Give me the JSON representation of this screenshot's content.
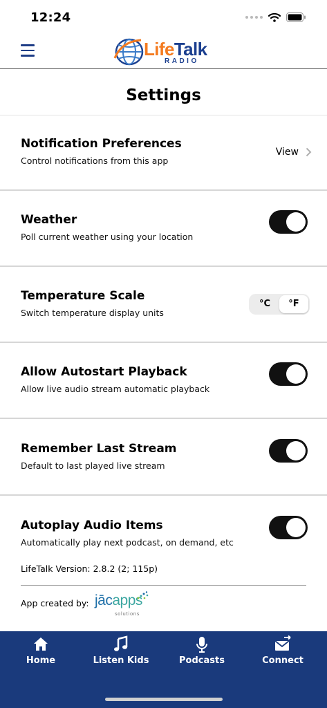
{
  "status_bar": {
    "time": "12:24"
  },
  "header": {
    "logo_word_1": "Life",
    "logo_word_2": "Talk",
    "logo_sub": "RADIO"
  },
  "page": {
    "title": "Settings"
  },
  "settings": [
    {
      "title": "Notification Preferences",
      "description": "Control notifications from this app",
      "action_label": "View"
    },
    {
      "title": "Weather",
      "description": "Poll current weather using your location",
      "enabled": true
    },
    {
      "title": "Temperature Scale",
      "description": "Switch temperature display units",
      "options": [
        "°C",
        "°F"
      ],
      "selected": "°F"
    },
    {
      "title": "Allow Autostart Playback",
      "description": "Allow live audio stream automatic playback",
      "enabled": true
    },
    {
      "title": "Remember Last Stream",
      "description": "Default to last played live stream",
      "enabled": true
    },
    {
      "title": "Autoplay Audio Items",
      "description": "Automatically play next podcast, on demand, etc",
      "enabled": true
    }
  ],
  "footer": {
    "version": "LifeTalk Version: 2.8.2 (2; 115p)",
    "credit_label": "App created by:",
    "credit_logo_main_1": "jāc",
    "credit_logo_main_2": "apps",
    "credit_logo_sub": "solutions"
  },
  "bottom_nav": [
    {
      "label": "Home",
      "icon": "home-icon"
    },
    {
      "label": "Listen Kids",
      "icon": "music-note-icon"
    },
    {
      "label": "Podcasts",
      "icon": "microphone-icon"
    },
    {
      "label": "Connect",
      "icon": "envelope-icon"
    }
  ],
  "colors": {
    "brand_blue": "#1a3a7c",
    "logo_orange": "#f47b20",
    "toggle_on": "#111111"
  }
}
